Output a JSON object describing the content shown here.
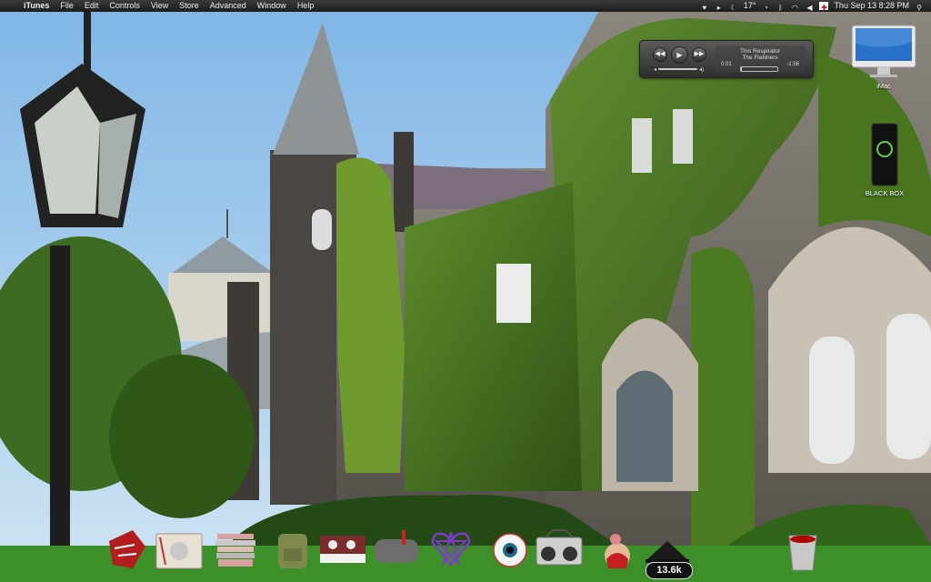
{
  "menubar": {
    "app_name": "iTunes",
    "menus": [
      "File",
      "Edit",
      "Controls",
      "View",
      "Store",
      "Advanced",
      "Window",
      "Help"
    ],
    "status": {
      "temperature": "17°",
      "datetime": "Thu Sep 13  8:28 PM"
    }
  },
  "itunes_controller": {
    "track": "This Respirator",
    "artist": "The Flatliners",
    "elapsed": "0:01",
    "remaining": "-1:56",
    "progress": 0.02
  },
  "desktop_icons": {
    "imac_label": "iMac",
    "blackbox_label": "BLACK BOX"
  },
  "dock": {
    "items": [
      "finder",
      "app-store",
      "stacks",
      "backpack",
      "synth",
      "mail",
      "heartagram",
      "eyeball",
      "boombox",
      "pinup",
      "hat",
      "trash"
    ],
    "badge": "13.6k"
  },
  "colors": {
    "sky": "#9cc9ec",
    "ivy": "#3f6a1e",
    "stone": "#6b6761",
    "lawn": "#3d8f2a",
    "menubar": "#2a2a2a"
  }
}
